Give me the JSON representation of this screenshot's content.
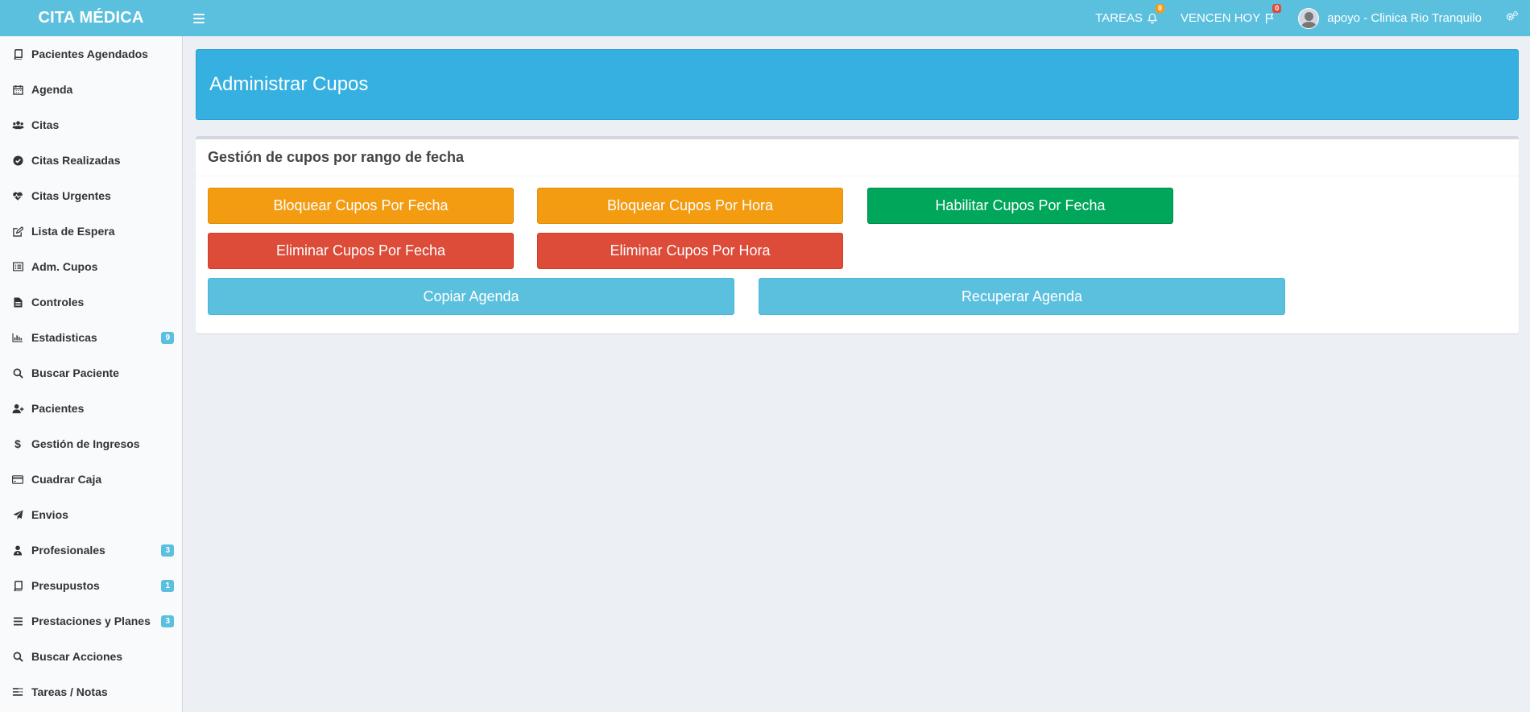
{
  "app": {
    "brand": "CITA MÉDICA"
  },
  "header": {
    "tasks_label": "TAREAS",
    "tasks_count": "0",
    "due_today_label": "VENCEN HOY",
    "due_today_count": "0",
    "user_label": "apoyo - Clinica Rio Tranquilo"
  },
  "sidebar": {
    "items": [
      {
        "label": "Pacientes Agendados",
        "icon": "book-icon"
      },
      {
        "label": "Agenda",
        "icon": "calendar-icon"
      },
      {
        "label": "Citas",
        "icon": "users-icon"
      },
      {
        "label": "Citas Realizadas",
        "icon": "check-circle-icon"
      },
      {
        "label": "Citas Urgentes",
        "icon": "heartbeat-icon"
      },
      {
        "label": "Lista de Espera",
        "icon": "edit-icon"
      },
      {
        "label": "Adm. Cupos",
        "icon": "list-alt-icon"
      },
      {
        "label": "Controles",
        "icon": "file-text-icon"
      },
      {
        "label": "Estadisticas",
        "icon": "bar-chart-icon",
        "badge": "9"
      },
      {
        "label": "Buscar Paciente",
        "icon": "search-icon"
      },
      {
        "label": "Pacientes",
        "icon": "user-plus-icon"
      },
      {
        "label": "Gestión de Ingresos",
        "icon": "dollar-icon"
      },
      {
        "label": "Cuadrar Caja",
        "icon": "credit-card-icon"
      },
      {
        "label": "Envios",
        "icon": "paper-plane-icon"
      },
      {
        "label": "Profesionales",
        "icon": "user-md-icon",
        "badge": "3"
      },
      {
        "label": "Presupustos",
        "icon": "book-icon",
        "badge": "1"
      },
      {
        "label": "Prestaciones y Planes",
        "icon": "bars-icon",
        "badge": "3"
      },
      {
        "label": "Buscar Acciones",
        "icon": "search-icon"
      },
      {
        "label": "Tareas / Notas",
        "icon": "tasks-icon"
      }
    ]
  },
  "main": {
    "page_title": "Administrar Cupos",
    "box_title": "Gestión de cupos por rango de fecha",
    "buttons": {
      "block_by_date": "Bloquear Cupos Por Fecha",
      "block_by_hour": "Bloquear Cupos Por Hora",
      "enable_by_date": "Habilitar Cupos Por Fecha",
      "delete_by_date": "Eliminar Cupos Por Fecha",
      "delete_by_hour": "Eliminar Cupos Por Hora",
      "copy_agenda": "Copiar Agenda",
      "recover_agenda": "Recuperar Agenda"
    }
  },
  "colors": {
    "header": "#5bc0de",
    "page_header": "#35b0e0",
    "warning": "#f39c12",
    "success": "#00a65a",
    "danger": "#dd4b39",
    "info": "#5bc0de"
  }
}
